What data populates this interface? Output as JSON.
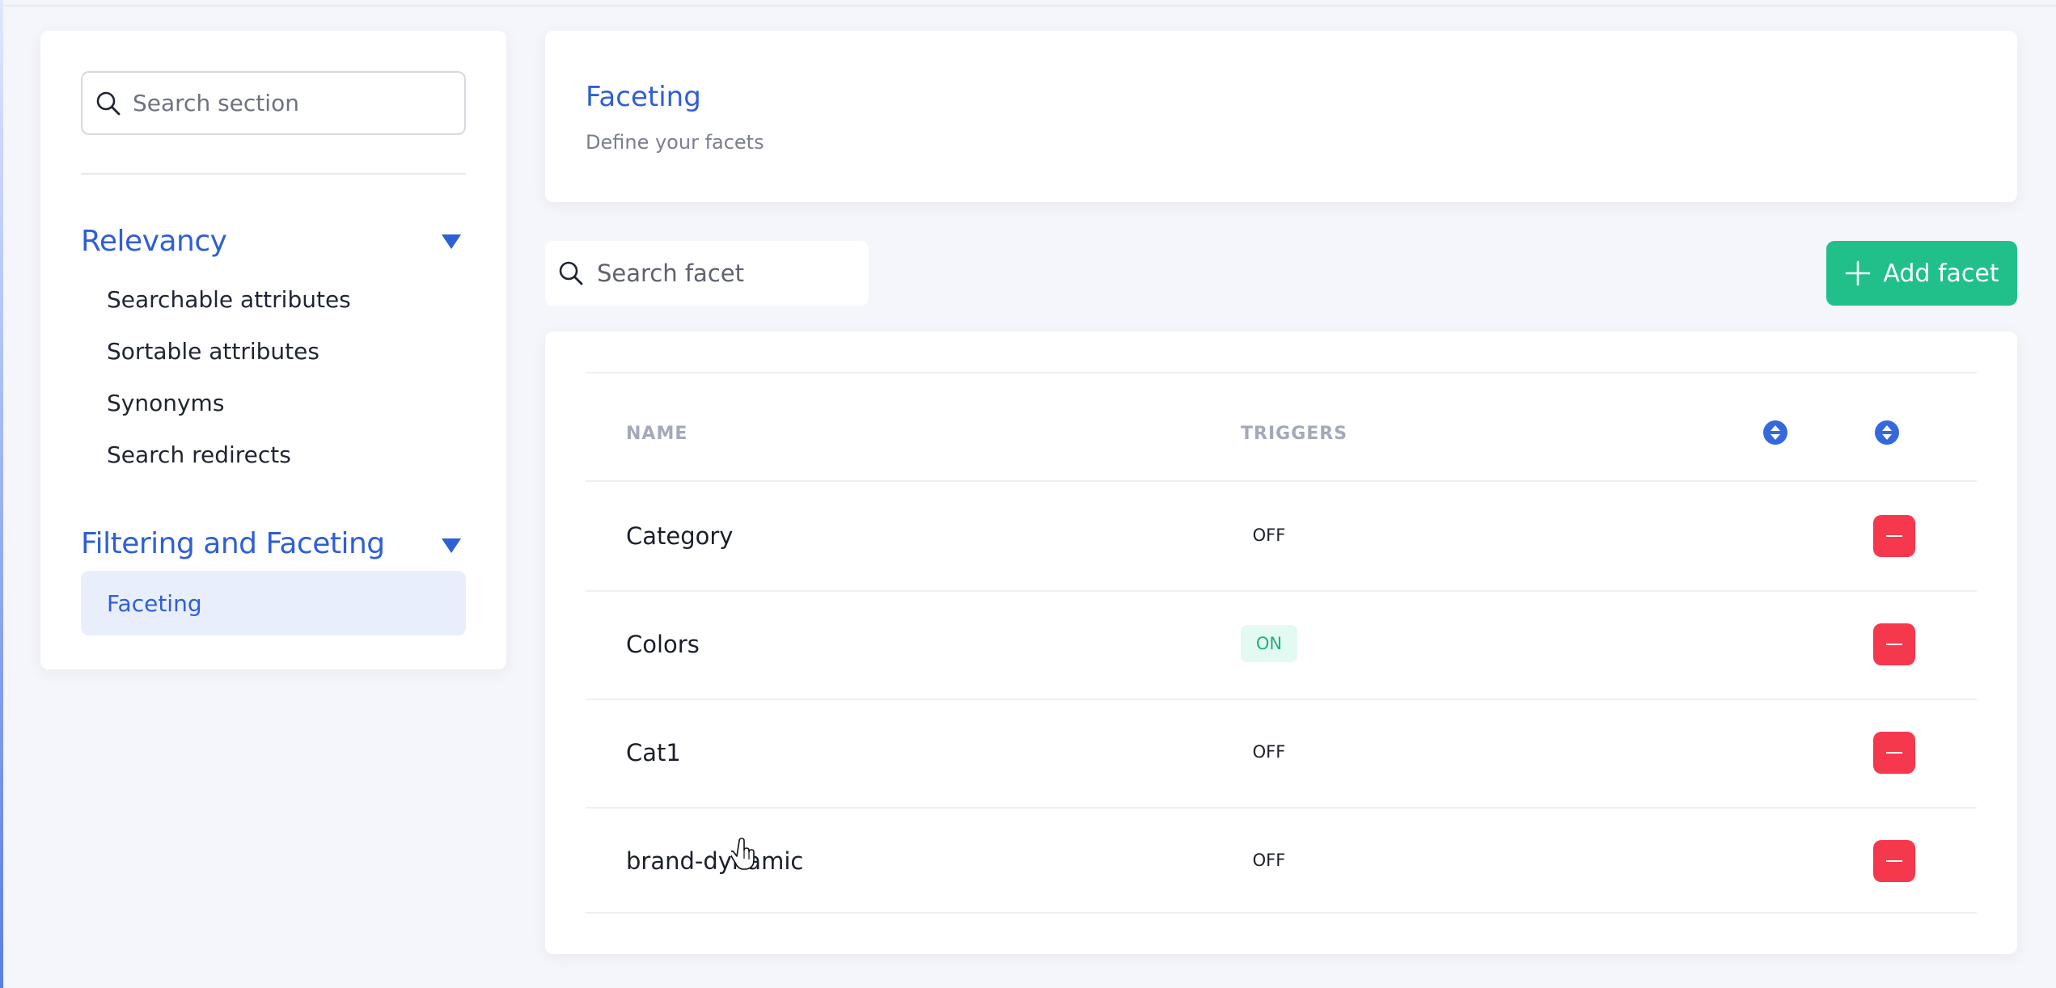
{
  "sidebar": {
    "search_placeholder": "Search section",
    "groups": [
      {
        "title": "Relevancy",
        "items": [
          "Searchable attributes",
          "Sortable attributes",
          "Synonyms",
          "Search redirects"
        ]
      },
      {
        "title": "Filtering and Faceting",
        "items": [
          "Faceting"
        ],
        "active_item": "Faceting"
      }
    ]
  },
  "header": {
    "title": "Faceting",
    "subtitle": "Define your facets"
  },
  "toolbar": {
    "search_placeholder": "Search facet",
    "add_label": "Add facet"
  },
  "table": {
    "columns": [
      "NAME",
      "TRIGGERS"
    ],
    "rows": [
      {
        "name": "Category",
        "trigger": "OFF"
      },
      {
        "name": "Colors",
        "trigger": "ON"
      },
      {
        "name": "Cat1",
        "trigger": "OFF"
      },
      {
        "name": "brand-dynamic",
        "trigger": "OFF"
      }
    ]
  },
  "colors": {
    "accent": "#2f5fd6",
    "success": "#21c08b",
    "danger": "#f6384d"
  },
  "icons": [
    "search-icon",
    "chevron-down-icon",
    "plus-icon",
    "sort-icon",
    "minus-icon",
    "hand-cursor-icon"
  ]
}
